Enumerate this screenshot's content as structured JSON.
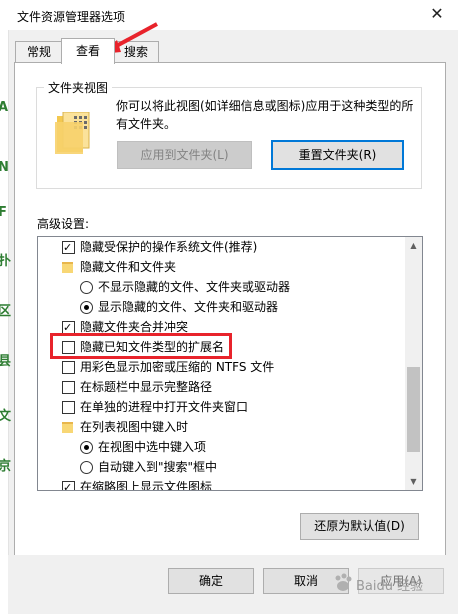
{
  "window": {
    "title": "文件资源管理器选项",
    "close_glyph": "✕"
  },
  "left_strip_chars": [
    "A",
    "N",
    "F",
    "扑",
    "区",
    "县",
    "文",
    "京"
  ],
  "tabs": [
    {
      "label": "常规",
      "active": false
    },
    {
      "label": "查看",
      "active": true
    },
    {
      "label": "搜索",
      "active": false
    }
  ],
  "folder_view": {
    "group_label": "文件夹视图",
    "description": "你可以将此视图(如详细信息或图标)应用于这种类型的所有文件夹。",
    "apply_button": "应用到文件夹(L)",
    "reset_button": "重置文件夹(R)"
  },
  "advanced": {
    "label": "高级设置:",
    "items": [
      {
        "type": "checkbox",
        "checked": true,
        "indent": 1,
        "label": "隐藏受保护的操作系统文件(推荐)"
      },
      {
        "type": "folder",
        "indent": 1,
        "label": "隐藏文件和文件夹"
      },
      {
        "type": "radio",
        "checked": false,
        "indent": 2,
        "label": "不显示隐藏的文件、文件夹或驱动器"
      },
      {
        "type": "radio",
        "checked": true,
        "indent": 2,
        "label": "显示隐藏的文件、文件夹和驱动器"
      },
      {
        "type": "checkbox",
        "checked": true,
        "indent": 1,
        "label": "隐藏文件夹合并冲突"
      },
      {
        "type": "checkbox",
        "checked": false,
        "indent": 1,
        "label": "隐藏已知文件类型的扩展名"
      },
      {
        "type": "checkbox",
        "checked": false,
        "indent": 1,
        "label": "用彩色显示加密或压缩的 NTFS 文件"
      },
      {
        "type": "checkbox",
        "checked": false,
        "indent": 1,
        "label": "在标题栏中显示完整路径"
      },
      {
        "type": "checkbox",
        "checked": false,
        "indent": 1,
        "label": "在单独的进程中打开文件夹窗口"
      },
      {
        "type": "folder",
        "indent": 1,
        "label": "在列表视图中键入时"
      },
      {
        "type": "radio",
        "checked": true,
        "indent": 2,
        "label": "在视图中选中键入项"
      },
      {
        "type": "radio",
        "checked": false,
        "indent": 2,
        "label": "自动键入到\"搜索\"框中"
      },
      {
        "type": "checkbox",
        "checked": true,
        "indent": 1,
        "label": "在缩略图上显示文件图标"
      }
    ],
    "restore_button": "还原为默认值(D)"
  },
  "footer": {
    "ok": "确定",
    "cancel": "取消",
    "apply": "应用(A)"
  },
  "watermark": "Baidu 经验",
  "colors": {
    "highlight": "#e8232b",
    "accent": "#0078d7",
    "folder": "#f8d775"
  }
}
